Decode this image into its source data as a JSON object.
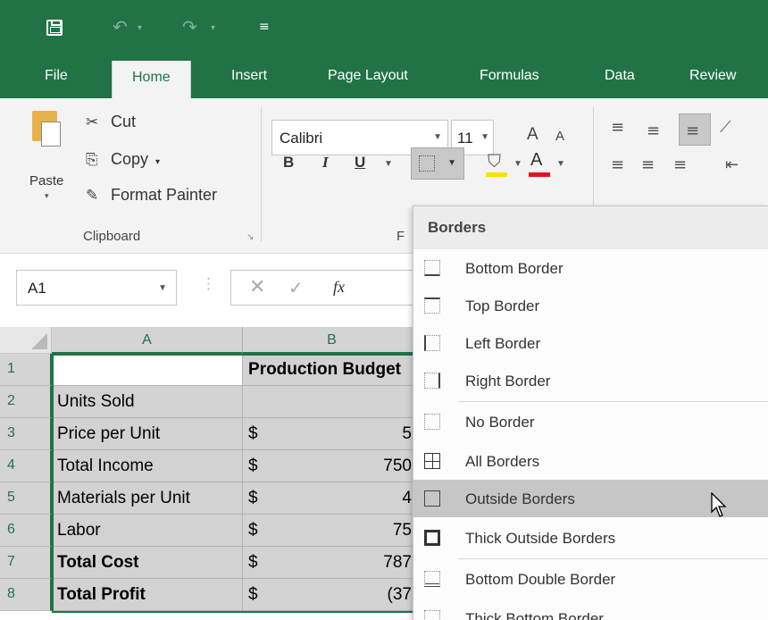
{
  "quick_access": {
    "icons": [
      "save-icon",
      "undo-icon",
      "redo-icon",
      "customize-qat-icon"
    ],
    "undo_glyph": "↶",
    "redo_glyph": "↷",
    "dropdown_glyph": "▾",
    "customize_glyph": "≡"
  },
  "tabs": [
    "File",
    "Home",
    "Insert",
    "Page Layout",
    "Formulas",
    "Data",
    "Review"
  ],
  "active_tab": "Home",
  "ribbon": {
    "clipboard": {
      "paste": "Paste",
      "cut": "Cut",
      "copy": "Copy",
      "format_painter": "Format Painter",
      "group_label": "Clipboard",
      "launcher": "↘"
    },
    "font": {
      "name": "Calibri",
      "size": "11",
      "grow": "A",
      "shrink": "A",
      "bold": "B",
      "italic": "I",
      "underline": "U",
      "color_letter": "A",
      "group_label_fragment": "F",
      "fill_color": "#f5e400",
      "font_color": "#e81123"
    },
    "alignment_glyphs": [
      "≡",
      "≡",
      "≡",
      "≣",
      "≡",
      "≡",
      "≡",
      "⇤"
    ]
  },
  "formula_bar": {
    "name_box": "A1",
    "cancel": "✕",
    "enter": "✓",
    "fx": "fx",
    "dots": "⋮"
  },
  "grid": {
    "columns": [
      "A",
      "B"
    ],
    "rows": [
      {
        "num": "1",
        "a": "",
        "b": "Production Budget",
        "a_bold": false,
        "b_bold": true,
        "dollar": ""
      },
      {
        "num": "2",
        "a": "Units Sold",
        "b": "",
        "a_bold": false,
        "dollar": ""
      },
      {
        "num": "3",
        "a": "Price per Unit",
        "b": "5",
        "a_bold": false,
        "dollar": "$"
      },
      {
        "num": "4",
        "a": "Total Income",
        "b": "750",
        "a_bold": false,
        "dollar": "$"
      },
      {
        "num": "5",
        "a": "Materials per Unit",
        "b": "4",
        "a_bold": false,
        "dollar": "$"
      },
      {
        "num": "6",
        "a": "Labor",
        "b": "75",
        "a_bold": false,
        "dollar": "$"
      },
      {
        "num": "7",
        "a": "Total Cost",
        "b": "787",
        "a_bold": true,
        "dollar": "$"
      },
      {
        "num": "8",
        "a": "Total Profit",
        "b": "(37",
        "a_bold": true,
        "dollar": "$"
      }
    ]
  },
  "borders_menu": {
    "title": "Borders",
    "items": [
      {
        "label": "Bottom Border",
        "icon": "bottom-border-icon"
      },
      {
        "label": "Top Border",
        "icon": "top-border-icon"
      },
      {
        "label": "Left Border",
        "icon": "left-border-icon"
      },
      {
        "label": "Right Border",
        "icon": "right-border-icon"
      },
      {
        "label": "No Border",
        "icon": "no-border-icon"
      },
      {
        "label": "All Borders",
        "icon": "all-borders-icon"
      },
      {
        "label": "Outside Borders",
        "icon": "outside-borders-icon",
        "highlighted": true
      },
      {
        "label": "Thick Outside Borders",
        "icon": "thick-outside-borders-icon"
      },
      {
        "label": "Bottom Double Border",
        "icon": "bottom-double-border-icon"
      },
      {
        "label": "Thick Bottom Border",
        "icon": "thick-bottom-border-icon"
      }
    ]
  },
  "colors": {
    "excel_green": "#217346",
    "highlight": "#c6c6c6"
  }
}
